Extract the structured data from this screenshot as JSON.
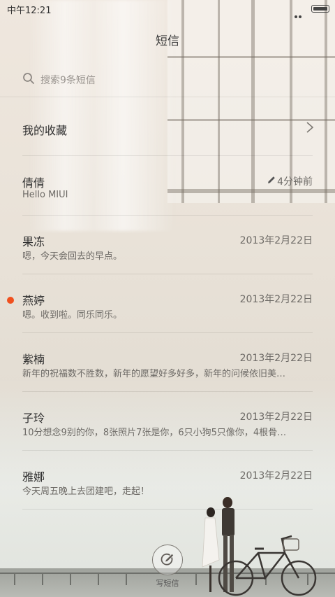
{
  "status_bar": {
    "time": "中午12:21"
  },
  "title": "短信",
  "search": {
    "placeholder": "搜索9条短信"
  },
  "favorites": {
    "label": "我的收藏"
  },
  "conversations": [
    {
      "name": "倩倩",
      "preview": "Hello MIUI",
      "time": "4分钟前",
      "draft": true,
      "unread": false
    },
    {
      "name": "果冻",
      "preview": "嗯，今天会回去的早点。",
      "time": "2013年2月22日",
      "draft": false,
      "unread": false
    },
    {
      "name": "燕婷",
      "preview": "嗯。收到啦。同乐同乐。",
      "time": "2013年2月22日",
      "draft": false,
      "unread": true
    },
    {
      "name": "紫楠",
      "preview": "新年的祝福数不胜数，新年的愿望好多好多，新年的问候依旧美…",
      "time": "2013年2月22日",
      "draft": false,
      "unread": false
    },
    {
      "name": "子玲",
      "preview": "10分想念9别的你，8张照片7张是你，6只小狗5只像你，4根骨…",
      "time": "2013年2月22日",
      "draft": false,
      "unread": false
    },
    {
      "name": "雅娜",
      "preview": "今天周五晚上去团建吧，走起！",
      "time": "2013年2月22日",
      "draft": false,
      "unread": false
    }
  ],
  "compose": {
    "label": "写短信"
  },
  "colors": {
    "unread_dot": "#f0501e",
    "text_primary": "#2f2f2f",
    "text_secondary": "#6d6a66"
  }
}
